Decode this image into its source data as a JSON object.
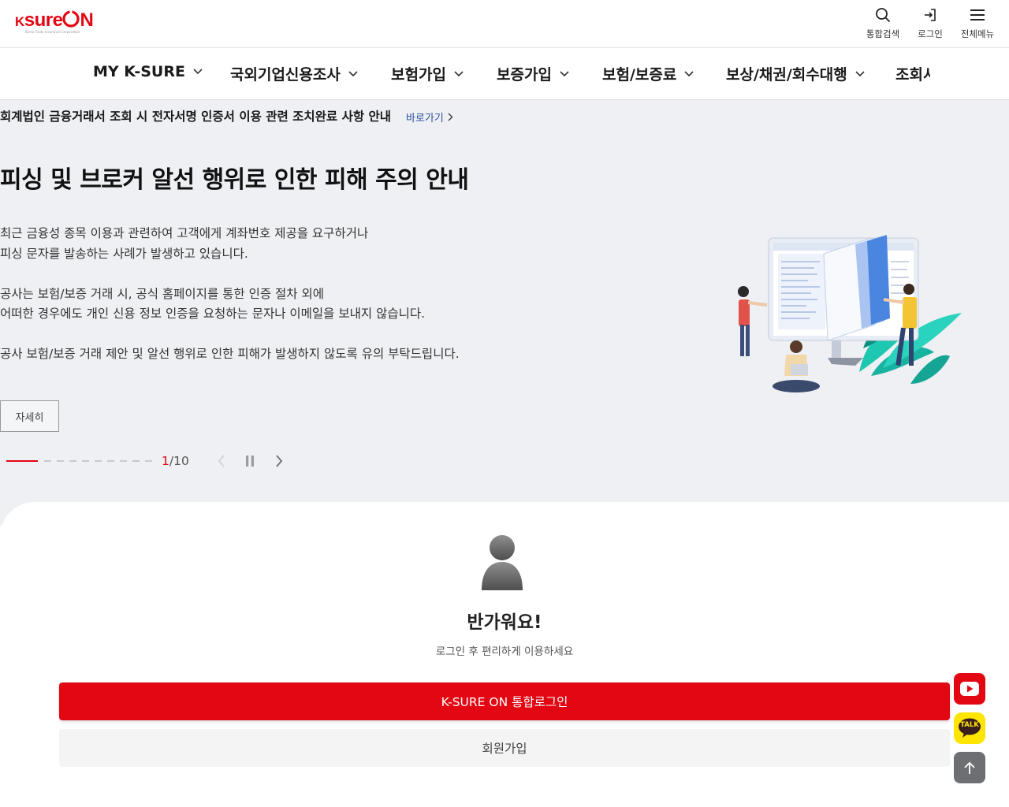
{
  "header": {
    "logo_text": "ksureON",
    "logo_sub": "Korea Trade Insurance Corporation",
    "utils": [
      {
        "label": "통합검색",
        "icon": "search-icon"
      },
      {
        "label": "로그인",
        "icon": "login-icon"
      },
      {
        "label": "전체메뉴",
        "icon": "hamburger-menu-icon"
      }
    ]
  },
  "gnb": {
    "items": [
      {
        "label": "MY K-SURE"
      },
      {
        "label": "국외기업신용조사"
      },
      {
        "label": "보험가입"
      },
      {
        "label": "보증가입"
      },
      {
        "label": "보험/보증료"
      },
      {
        "label": "보상/채권/회수대행"
      },
      {
        "label": "조회서"
      }
    ]
  },
  "notice": {
    "text": "회계법인 금융거래서 조회 시 전자서명 인증서 이용 관련 조치완료 사항 안내",
    "link_label": "바로가기"
  },
  "hero": {
    "title": "피싱 및 브로커 알선 행위로 인한 피해 주의 안내",
    "paragraphs": [
      "최근 금융성 종목 이용과 관련하여 고객에게 계좌번호 제공을 요구하거나",
      "피싱 문자를 발송하는 사례가 발생하고 있습니다.",
      "공사는 보험/보증 거래 시, 공식 홈페이지를 통한 인증 절차 외에",
      "어떠한 경우에도 개인 신용 정보 인증을 요청하는 문자나 이메일을 보내지 않습니다.",
      "공사 보험/보증 거래 제안 및 알선 행위로 인한 피해가 발생하지 않도록 유의 부탁드립니다."
    ],
    "more_label": "자세히",
    "pager": {
      "current": "1",
      "separator": "/",
      "total": "10"
    }
  },
  "login_card": {
    "greeting": "반가워요!",
    "subtext": "로그인 후 편리하게 이용하세요",
    "login_label": "K-SURE ON 통합로그인",
    "join_label": "회원가입"
  },
  "floating": {
    "kakao_label": "TALK"
  },
  "colors": {
    "brand_red": "#e30613",
    "hero_bg": "#eef0f3",
    "link_blue": "#2a4d9b",
    "kakao_yellow": "#fee500"
  }
}
